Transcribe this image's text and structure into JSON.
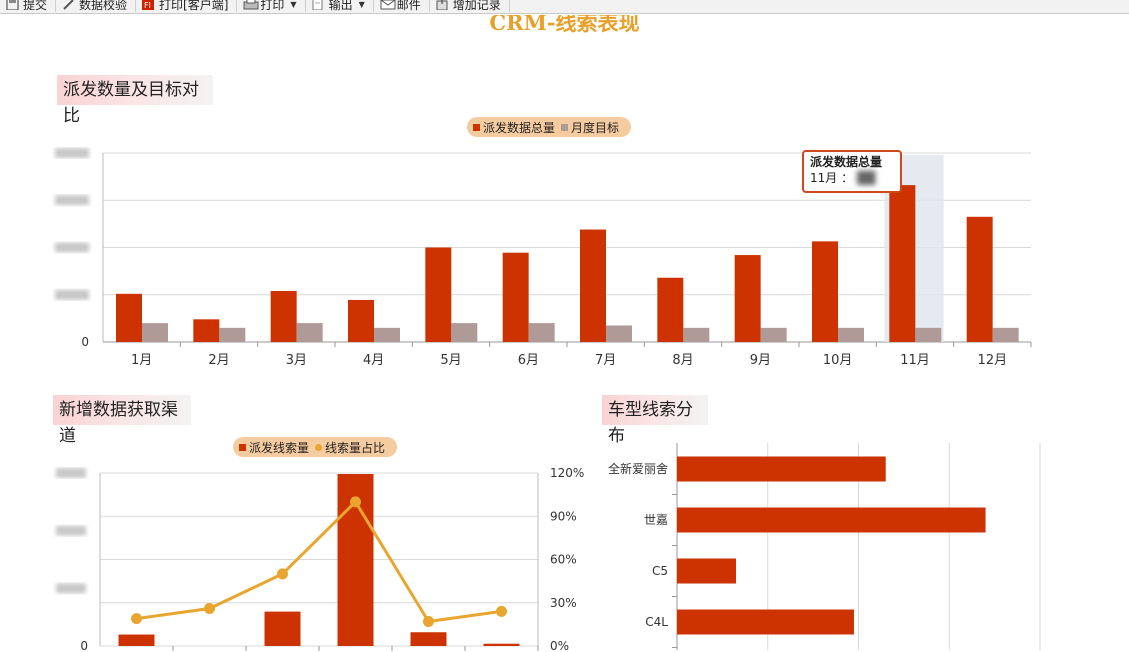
{
  "toolbar": {
    "items": [
      {
        "label": "提交",
        "icon": "save-icon"
      },
      {
        "label": "数据校验",
        "icon": "validate-icon"
      },
      {
        "label": "打印[客户端]",
        "icon": "flash-print-icon"
      },
      {
        "label": "打印",
        "icon": "printer-icon"
      },
      {
        "label": "输出",
        "icon": "export-icon"
      },
      {
        "label": "邮件",
        "icon": "mail-icon"
      },
      {
        "label": "增加记录",
        "icon": "add-record-icon"
      }
    ]
  },
  "page": {
    "title": "CRM-线索表现"
  },
  "sections": {
    "chart1_title": "派发数量及目标对比",
    "chart2_title": "新增数据获取渠道",
    "chart3_title": "车型线索分布"
  },
  "colors": {
    "primary_bar": "#cc3300",
    "target_bar": "#b09a98",
    "line": "#e8a630",
    "legend_bg": "#f5cba0",
    "title_accent": "#e8a02a"
  },
  "tooltip": {
    "series": "派发数据总量",
    "category": "11月",
    "separator": "："
  },
  "chart_data": [
    {
      "type": "bar",
      "title": "派发数量及目标对比",
      "categories": [
        "1月",
        "2月",
        "3月",
        "4月",
        "5月",
        "6月",
        "7月",
        "8月",
        "9月",
        "10月",
        "11月",
        "12月"
      ],
      "series": [
        {
          "name": "派发数据总量",
          "color": "#cc3300",
          "values": [
            10200,
            4800,
            10800,
            8900,
            20000,
            18900,
            23800,
            13600,
            18400,
            21300,
            33200,
            26500
          ]
        },
        {
          "name": "月度目标",
          "color": "#b09a98",
          "values": [
            4000,
            3000,
            4000,
            3000,
            4000,
            4000,
            3500,
            3000,
            3000,
            3000,
            3000,
            3000
          ]
        }
      ],
      "ylim": [
        0,
        40000
      ],
      "yticks": [
        0,
        10000,
        20000,
        30000,
        40000
      ],
      "ytick_labels_visible": [
        "0"
      ],
      "legend": "top-center",
      "grid": true
    },
    {
      "type": "bar",
      "title": "新增数据获取渠道",
      "categories": [
        "",
        "",
        "",
        "",
        "",
        ""
      ],
      "series": [
        {
          "name": "派发线索量",
          "type": "bar",
          "color": "#cc3300",
          "values": [
            1000,
            0,
            3000,
            15000,
            1200,
            200
          ]
        },
        {
          "name": "线索量占比",
          "type": "line",
          "color": "#e8a630",
          "axis": "right",
          "values": [
            19,
            26,
            50,
            100,
            17,
            24
          ]
        }
      ],
      "ylim": [
        0,
        15000
      ],
      "y2lim": [
        0,
        120
      ],
      "yticks_visible": [
        "0"
      ],
      "y2ticks": [
        "0%",
        "30%",
        "60%",
        "90%",
        "120%"
      ],
      "legend": "top-center",
      "grid": true
    },
    {
      "type": "bar",
      "orientation": "horizontal",
      "title": "车型线索分布",
      "categories": [
        "全新爱丽舍",
        "世嘉",
        "C5",
        "C4L"
      ],
      "values": [
        23,
        34,
        6.5,
        19.5
      ],
      "xlim": [
        0,
        40
      ],
      "grid": true
    }
  ]
}
